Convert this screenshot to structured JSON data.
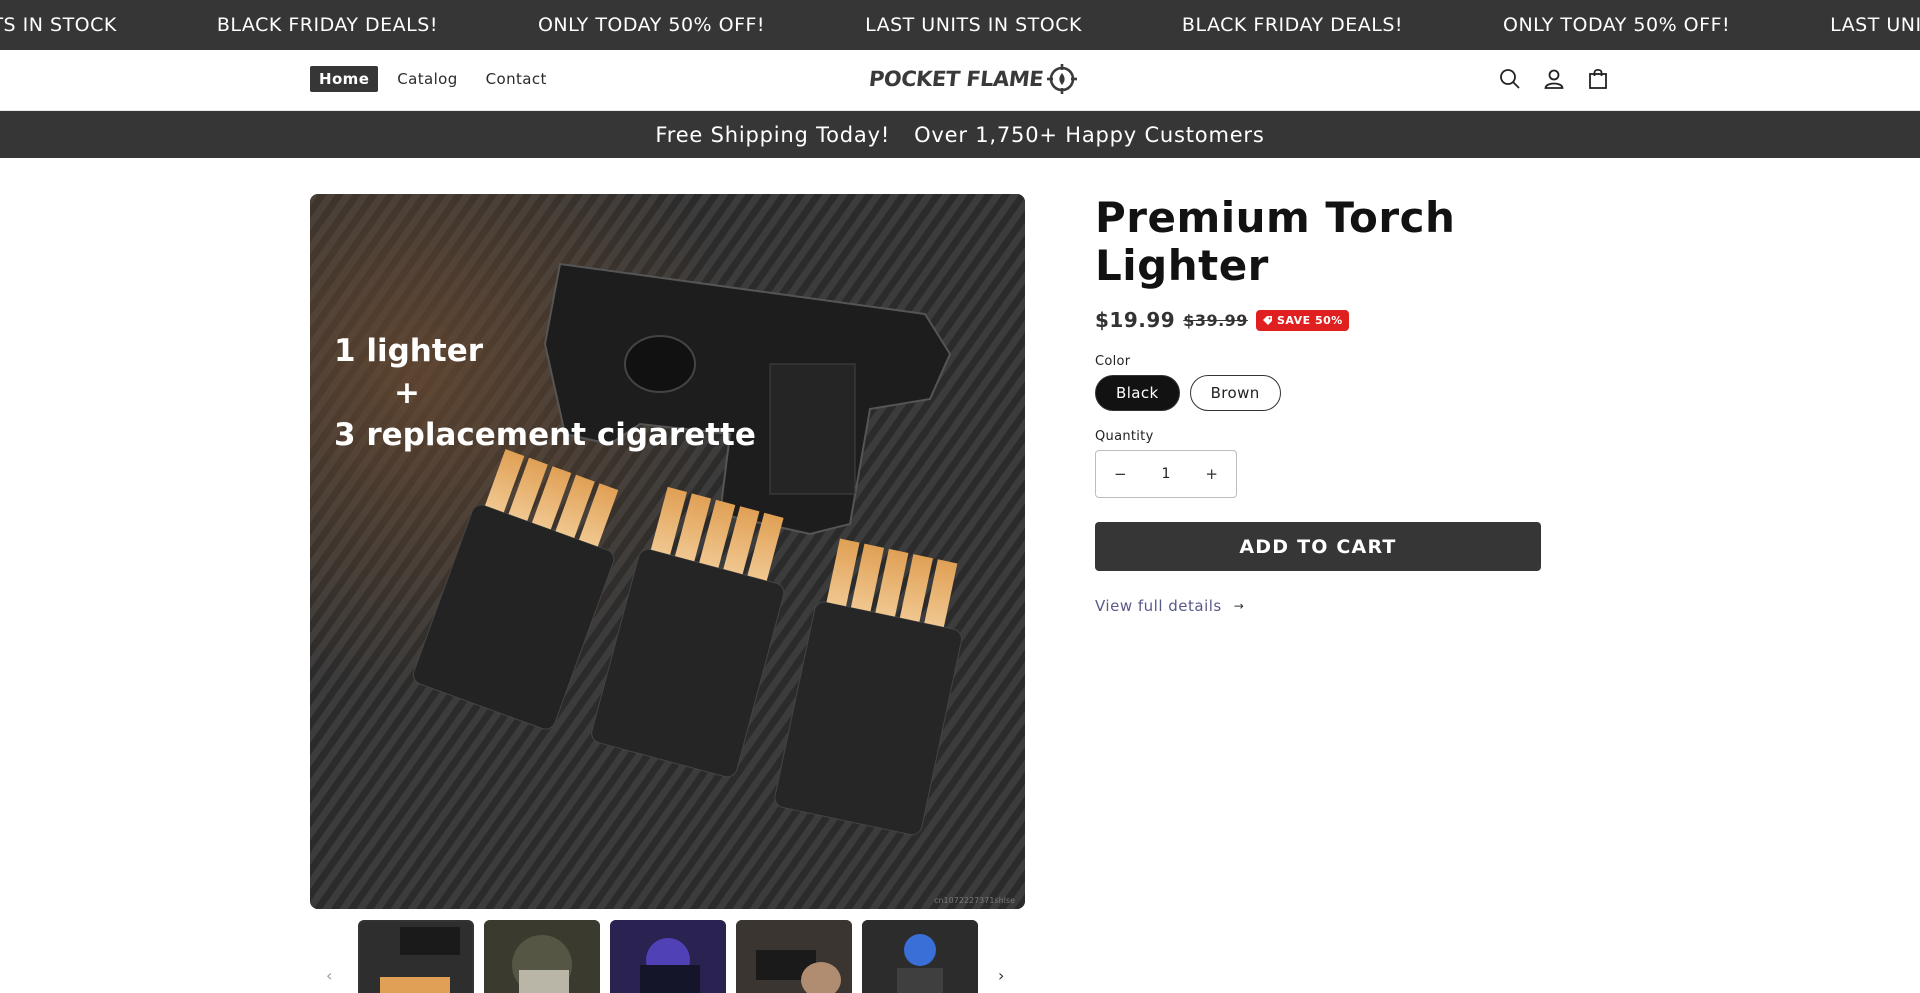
{
  "marquee": {
    "items": [
      "LAST UNITS IN STOCK",
      "BLACK FRIDAY DEALS!",
      "ONLY TODAY 50% OFF!",
      "LAST UNITS IN STOCK",
      "BLACK FRIDAY DEALS!",
      "ONLY TODAY 50% OFF!",
      "LAST UNITS IN STOCK"
    ]
  },
  "header": {
    "nav": [
      "Home",
      "Catalog",
      "Contact"
    ],
    "active_nav": "Home",
    "logo_text": "POCKET FLAME",
    "icons": [
      "search-icon",
      "account-icon",
      "cart-icon"
    ]
  },
  "announcement": {
    "items": [
      "Free Shipping Today!",
      "Over 1,750+ Happy Customers"
    ]
  },
  "gallery": {
    "overlay_lines": [
      "1 lighter",
      "+",
      "3 replacement cigarette"
    ],
    "watermark": "cn1072227371shlse",
    "thumbnail_count": 5,
    "active_thumbnail": 1
  },
  "product": {
    "title": "Premium Torch Lighter",
    "price": "$19.99",
    "compare_price": "$39.99",
    "badge": "SAVE 50%",
    "color_label": "Color",
    "colors": [
      "Black",
      "Brown"
    ],
    "selected_color": "Black",
    "quantity_label": "Quantity",
    "quantity": "1",
    "minus": "−",
    "plus": "+",
    "add_to_cart": "ADD TO CART",
    "view_details": "View full details",
    "arrow": "→"
  },
  "colors": {
    "dark_bar": "#363636",
    "badge_red": "#e02020",
    "link": "#5a5a8a"
  }
}
